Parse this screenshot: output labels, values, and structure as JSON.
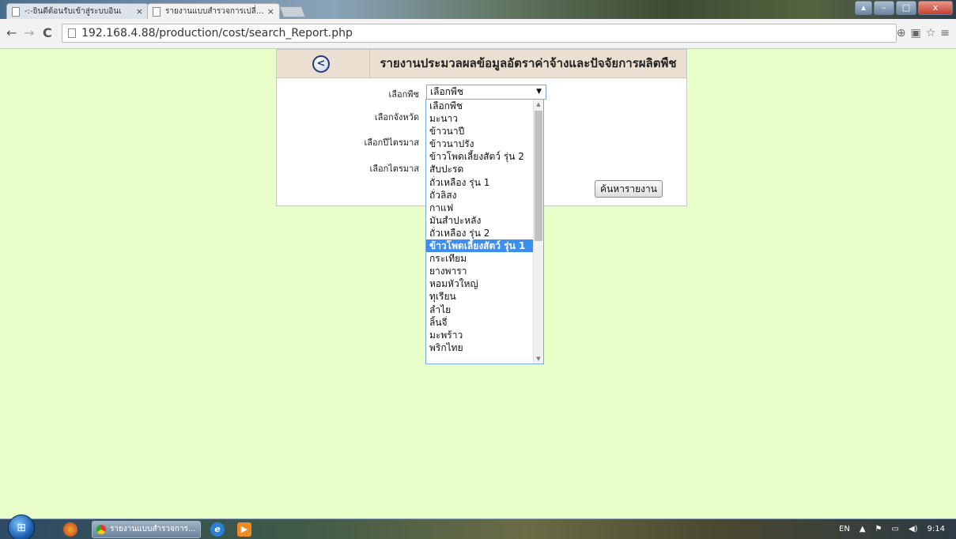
{
  "browser": {
    "tabs": [
      {
        "label": "-:-ยินดีต้อนรับเข้าสู่ระบบอินเ",
        "close": "×"
      },
      {
        "label": "รายงานแบบสำรวจการเปลี่ยนแ",
        "close": "×"
      }
    ],
    "url": "192.168.4.88/production/cost/search_Report.php",
    "nav": {
      "back": "←",
      "forward": "→",
      "reload": "C"
    },
    "toolbar_icons": {
      "zoom": "⊕",
      "translate": "▣",
      "star": "☆",
      "menu": "≡"
    },
    "window_buttons": {
      "user": "▴",
      "minimize": "–",
      "maximize": "□",
      "close": "x"
    }
  },
  "page": {
    "title": "รายงานประมวลผลข้อมูลอัตราค่าจ้างและปัจจัยการผลิตพืช",
    "back_icon": "<",
    "labels": {
      "crop": "เลือกพืช",
      "province": "เลือกจังหวัด",
      "year_quarter": "เลือกปีไตรมาส",
      "quarter": "เลือกไตรมาส"
    },
    "crop_select_value": "เลือกพืช",
    "select_arrow": "▼",
    "search_button": "ค้นหารายงาน",
    "dropdown_options": [
      "เลือกพืช",
      "มะนาว",
      "ข้าวนาปี",
      "ข้าวนาปรัง",
      "ข้าวโพดเลี้ยงสัตว์ รุ่น 2",
      "สับปะรด",
      "ถั่วเหลือง รุ่น 1",
      "ถั่วลิสง",
      "กาแฟ",
      "มันสำปะหลัง",
      "ถั่วเหลือง รุ่น 2",
      "ข้าวโพดเลี้ยงสัตว์ รุ่น 1",
      "กระเทียม",
      "ยางพารา",
      "หอมหัวใหญ่",
      "ทุเรียน",
      "ลำไย",
      "ลิ้นจี่",
      "มะพร้าว",
      "พริกไทย"
    ],
    "dropdown_selected_index": 11
  },
  "taskbar": {
    "chrome_task_label": "รายงานแบบสำรวจการ...",
    "tray": {
      "lang": "EN",
      "up_arrow": "▲",
      "flag": "⚑",
      "network": "▭",
      "volume": "◀)",
      "time": "9:14"
    }
  }
}
